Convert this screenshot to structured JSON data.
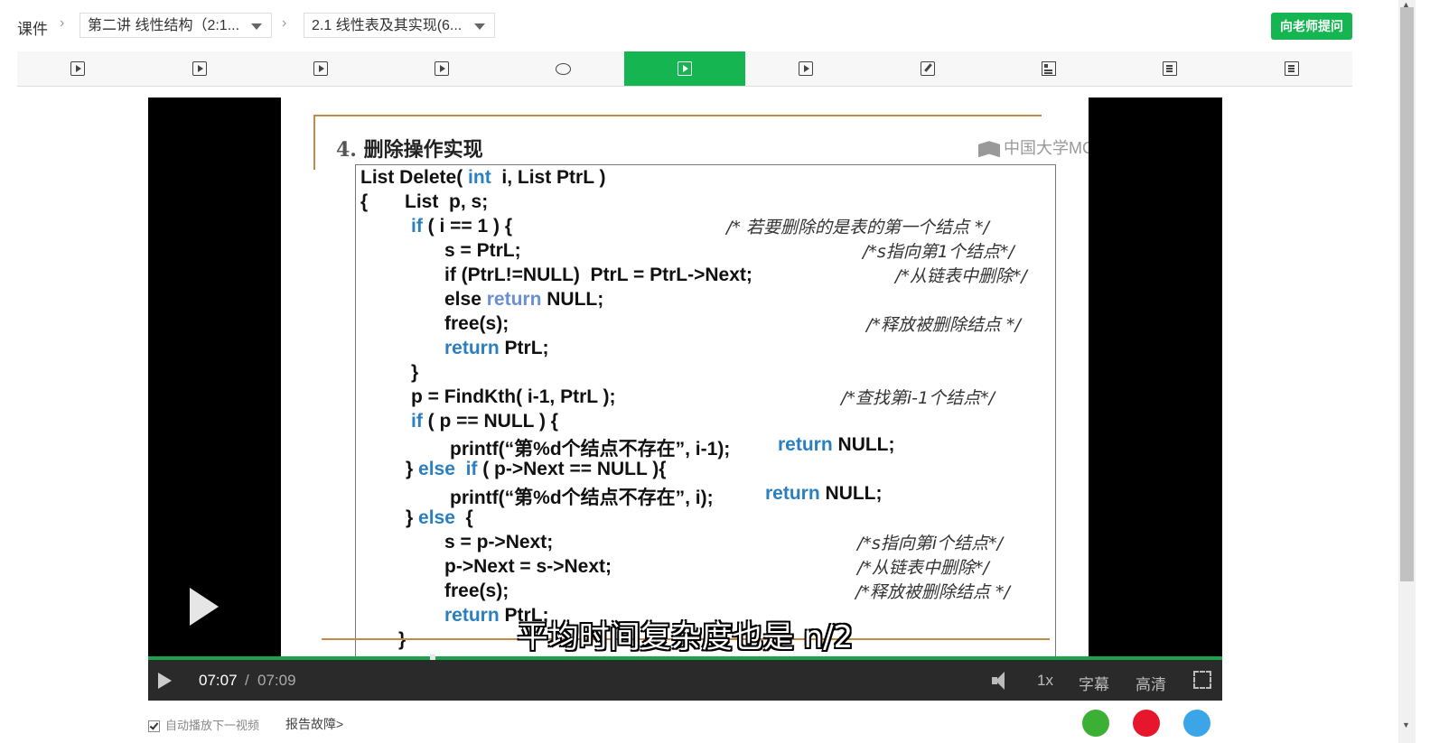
{
  "breadcrumb": {
    "root": "课件",
    "chapter": "第二讲 线性结构（2:1...",
    "section": "2.1 线性表及其实现(6..."
  },
  "ask_button": "向老师提问",
  "tabs": [
    {
      "icon": "video-icon"
    },
    {
      "icon": "video-icon"
    },
    {
      "icon": "video-icon"
    },
    {
      "icon": "video-icon"
    },
    {
      "icon": "discussion-icon"
    },
    {
      "icon": "video-icon",
      "active": true
    },
    {
      "icon": "video-icon"
    },
    {
      "icon": "quiz-icon"
    },
    {
      "icon": "document-icon"
    },
    {
      "icon": "document-icon"
    },
    {
      "icon": "document-icon"
    }
  ],
  "slide": {
    "title_num": "4.",
    "title": "删除操作实现",
    "watermark": "中国大学MC",
    "code": [
      "List Delete( int  i, List PtrL )",
      "{       List  p, s;",
      "if ( i == 1 ) {",
      "s = PtrL;",
      "if (PtrL!=NULL)  PtrL = PtrL->Next;",
      "else return NULL;",
      "free(s);",
      "return PtrL;",
      "}",
      "p = FindKth( i-1, PtrL );",
      "if ( p == NULL ) {",
      "printf(“第%d个结点不存在”, i-1);",
      "return NULL;",
      "} else  if ( p->Next == NULL ){",
      "printf(“第%d个结点不存在”, i);",
      "return NULL;",
      "} else  {",
      "s = p->Next;",
      "p->Next = s->Next;",
      "free(s);",
      "return PtrL;",
      "}"
    ],
    "comments": [
      "/* 若要删除的是表的第一个结点 */",
      "/*s指向第1个结点*/",
      "/*从链表中删除*/",
      "/*释放被删除结点 */",
      "/*查找第i-1个结点*/",
      "/*s指向第i个结点*/",
      "/*从链表中删除*/",
      "/*释放被删除结点 */"
    ]
  },
  "subtitle": "平均时间复杂度也是 n/2",
  "player": {
    "current_time": "07:07",
    "separator": "/",
    "total_time": "07:09",
    "progress_fraction": 0.995,
    "speed": "1x",
    "captions": "字幕",
    "quality": "高清"
  },
  "autoplay_label": "自动播放下一视频",
  "report_label": "报告故障>",
  "share": [
    {
      "icon": "wechat-icon",
      "color": "#3cb034"
    },
    {
      "icon": "weibo-icon",
      "color": "#e6162d"
    },
    {
      "icon": "qq-icon",
      "color": "#3aa6e8"
    }
  ],
  "colors": {
    "accent": "#15b552",
    "keyword": "#2a7fc1"
  }
}
